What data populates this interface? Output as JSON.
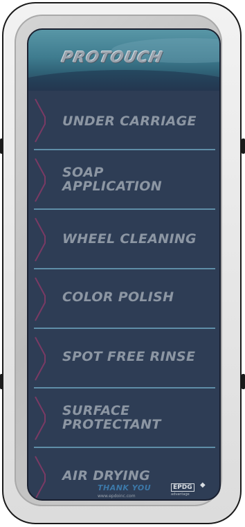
{
  "header": {
    "logo_text": "PROTOUCH"
  },
  "menu": {
    "items": [
      {
        "label": "UNDER CARRIAGE",
        "icon": "chevron-right-icon"
      },
      {
        "label": "SOAP\nAPPLICATION",
        "icon": "chevron-right-icon"
      },
      {
        "label": "WHEEL CLEANING",
        "icon": "chevron-right-icon"
      },
      {
        "label": "COLOR POLISH",
        "icon": "chevron-right-icon"
      },
      {
        "label": "SPOT FREE RINSE",
        "icon": "chevron-right-icon"
      },
      {
        "label": "SURFACE\nPROTECTANT",
        "icon": "chevron-right-icon"
      },
      {
        "label": "AIR DRYING",
        "icon": "chevron-right-icon"
      }
    ]
  },
  "footer": {
    "thanks": "THANK YOU",
    "url": "www.epdoinc.com",
    "brand": "EPDG",
    "brand_sub": "advantage",
    "arrow": "◆"
  },
  "colors": {
    "screen_bg": "#2e3d55",
    "label": "#8c96a3",
    "divider": "#5f8ea8",
    "chevron": "#7a3a64",
    "thanks": "#3c78a8"
  }
}
